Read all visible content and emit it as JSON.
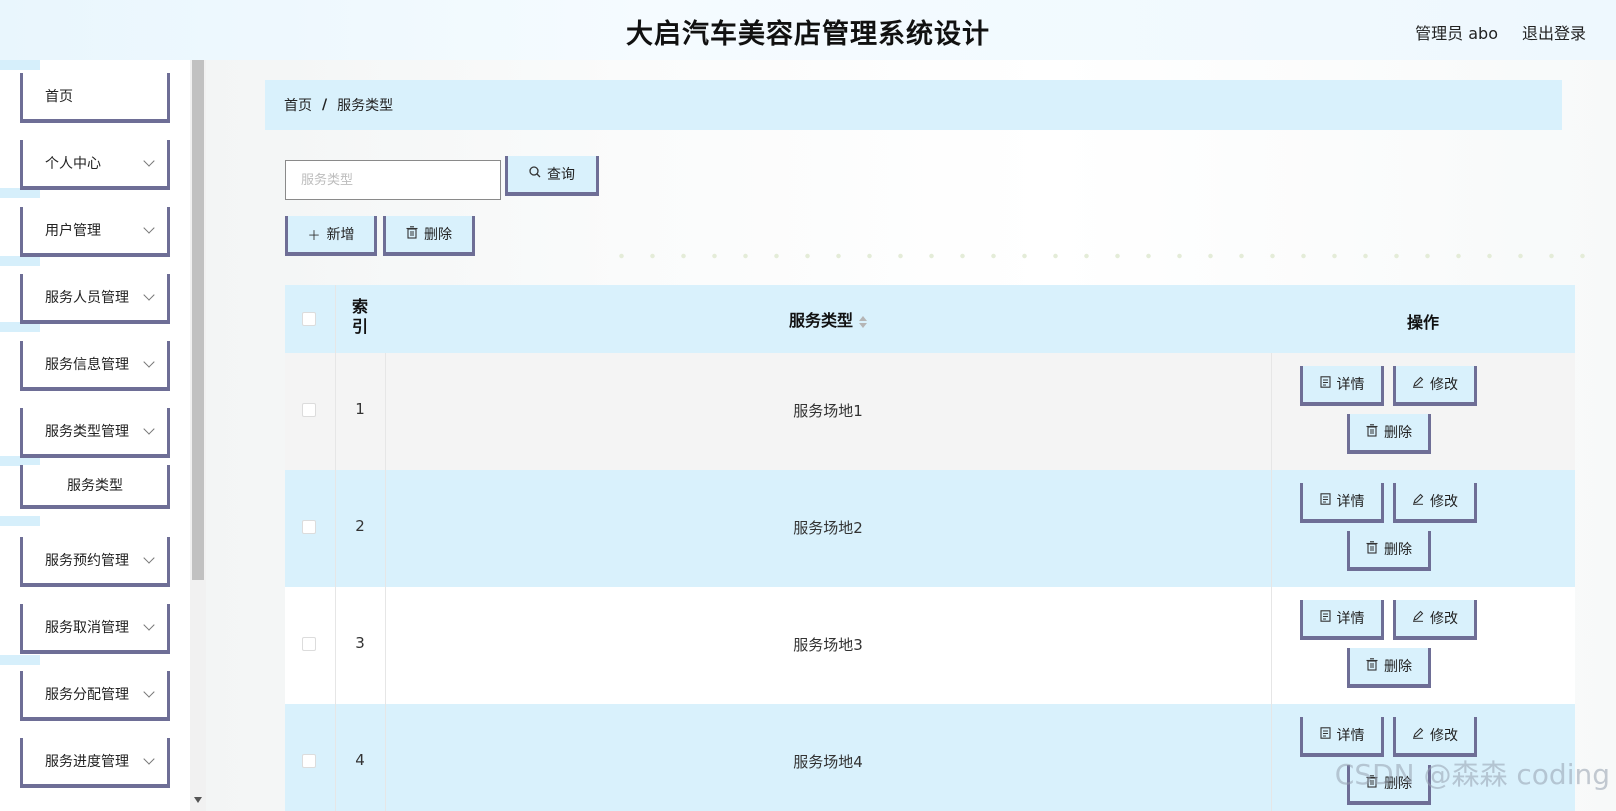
{
  "header": {
    "title": "大启汽车美容店管理系统设计",
    "user": "管理员 abo",
    "logout": "退出登录"
  },
  "sidebar": {
    "items": [
      {
        "label": "首页",
        "expandable": false
      },
      {
        "label": "个人中心",
        "expandable": true
      },
      {
        "label": "用户管理",
        "expandable": true
      },
      {
        "label": "服务人员管理",
        "expandable": true
      },
      {
        "label": "服务信息管理",
        "expandable": true
      },
      {
        "label": "服务类型管理",
        "expandable": true
      },
      {
        "label": "服务类型",
        "expandable": false,
        "sub": true
      },
      {
        "label": "服务预约管理",
        "expandable": true
      },
      {
        "label": "服务取消管理",
        "expandable": true
      },
      {
        "label": "服务分配管理",
        "expandable": true
      },
      {
        "label": "服务进度管理",
        "expandable": true
      }
    ]
  },
  "breadcrumb": {
    "home": "首页",
    "separator": "/",
    "current": "服务类型"
  },
  "search": {
    "placeholder": "服务类型",
    "value": "",
    "button": "查询"
  },
  "toolbar": {
    "add": "新增",
    "delete": "删除"
  },
  "table": {
    "headers": {
      "index": "索引",
      "service_type": "服务类型",
      "actions": "操作"
    },
    "rows": [
      {
        "index": "1",
        "service_type": "服务场地1"
      },
      {
        "index": "2",
        "service_type": "服务场地2"
      },
      {
        "index": "3",
        "service_type": "服务场地3"
      },
      {
        "index": "4",
        "service_type": "服务场地4"
      }
    ],
    "row_actions": {
      "detail": "详情",
      "edit": "修改",
      "delete": "删除"
    }
  },
  "watermark": "CSDN @森森 coding",
  "colors": {
    "accent_light": "#d9f1fc",
    "button_border": "#6e6e96",
    "row_gray": "#f4f4f4"
  }
}
